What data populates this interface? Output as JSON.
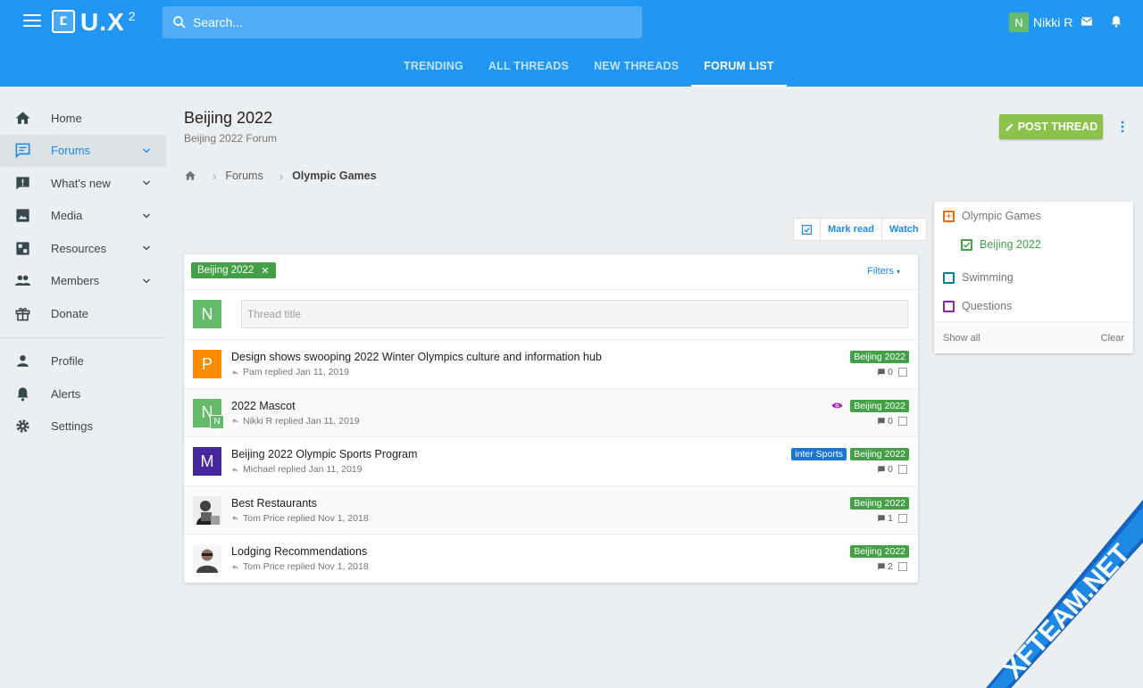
{
  "header": {
    "logo_icon": "ⵎ",
    "logo_text": "U.X",
    "logo_sup": "2",
    "search_placeholder": "Search...",
    "user_initial": "N",
    "user_name": "Nikki R",
    "accent": "#2196f3"
  },
  "tabs": [
    {
      "label": "TRENDING"
    },
    {
      "label": "ALL THREADS"
    },
    {
      "label": "NEW THREADS"
    },
    {
      "label": "FORUM LIST",
      "active": true
    }
  ],
  "sidebar": {
    "items": [
      {
        "label": "Home",
        "icon": "home-icon"
      },
      {
        "label": "Forums",
        "icon": "chat-icon",
        "active": true
      },
      {
        "label": "What's new",
        "icon": "feedback-icon"
      },
      {
        "label": "Media",
        "icon": "image-icon"
      },
      {
        "label": "Resources",
        "icon": "resource-icon"
      },
      {
        "label": "Members",
        "icon": "people-icon"
      },
      {
        "label": "Donate",
        "icon": "gift-icon"
      }
    ],
    "account": [
      {
        "label": "Profile",
        "icon": "person-icon"
      },
      {
        "label": "Alerts",
        "icon": "bell-icon"
      },
      {
        "label": "Settings",
        "icon": "gear-icon"
      }
    ]
  },
  "page": {
    "title": "Beijing 2022",
    "subtitle": "Beijing 2022 Forum",
    "post_label": "POST THREAD"
  },
  "breadcrumb": {
    "items": [
      "Forums",
      "Olympic Games"
    ]
  },
  "actions": {
    "mark_read": "Mark read",
    "watch": "Watch"
  },
  "thread_list": {
    "active_prefix": "Beijing 2022",
    "filters_label": "Filters",
    "quick_initial": "N",
    "title_placeholder": "Thread title",
    "threads": [
      {
        "title": "Design shows swooping 2022 Winter Olympics culture and information hub",
        "meta": "Pam replied Jan 11, 2019",
        "prefix": "Beijing 2022",
        "replies": "0",
        "avatar": "P",
        "avatar_color": "#fb8c00"
      },
      {
        "title": "2022 Mascot",
        "meta": "Nikki R replied Jan 11, 2019",
        "prefix": "Beijing 2022",
        "replies": "0",
        "avatar": "N",
        "avatar_color": "#66bb6a",
        "mini_avatar": "N"
      },
      {
        "title": "Beijing 2022 Olympic Sports Program",
        "meta": "Michael replied Jan 11, 2019",
        "prefix": "Beijing 2022",
        "prefix2": "inter Sports",
        "replies": "0",
        "avatar": "M",
        "avatar_color": "#4527a0"
      },
      {
        "title": "Best Restaurants",
        "meta": "Tom Price replied Nov 1, 2018",
        "prefix": "Beijing 2022",
        "replies": "1"
      },
      {
        "title": "Lodging Recommendations",
        "meta": "Tom Price replied Nov 1, 2018",
        "prefix": "Beijing 2022",
        "replies": "2"
      }
    ]
  },
  "filter_panel": {
    "items": [
      {
        "label": "Olympic Games",
        "color": "#ef6c00"
      },
      {
        "label": "Beijing 2022",
        "color": "#43a047",
        "checked": true
      },
      {
        "label": "Swimming",
        "color": "#00838f"
      },
      {
        "label": "Questions",
        "color": "#8e24aa"
      }
    ],
    "show_all": "Show all",
    "clear": "Clear"
  },
  "watermark": "XFTEAM.NET"
}
